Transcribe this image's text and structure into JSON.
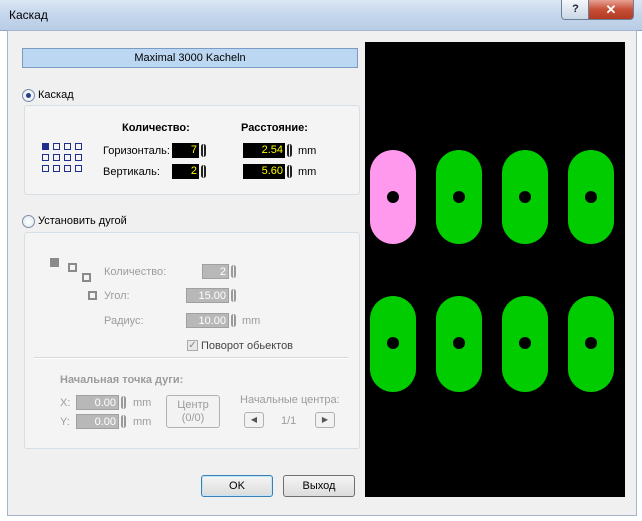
{
  "window": {
    "title": "Каскад",
    "help_glyph": "?",
    "close_glyph": "✕"
  },
  "header": {
    "label": "Maximal 3000 Kacheln"
  },
  "cascade": {
    "radio_label": "Каскад",
    "count_header": "Количество:",
    "distance_header": "Расстояние:",
    "horizontal_label": "Горизонталь:",
    "vertical_label": "Вертикаль:",
    "horizontal_count": "7",
    "vertical_count": "2",
    "horizontal_distance": "2.54",
    "vertical_distance": "5.60",
    "unit": "mm"
  },
  "arc": {
    "radio_label": "Установить дугой",
    "count_label": "Количество:",
    "count_value": "2",
    "angle_label": "Угол:",
    "angle_value": "15.00",
    "radius_label": "Радиус:",
    "radius_value": "10.00",
    "unit": "mm",
    "rotate_label": "Поворот обьектов",
    "rotate_check": "✓",
    "start_title": "Начальная точка дуги:",
    "x_label": "X:",
    "x_value": "0.00",
    "y_label": "Y:",
    "y_value": "0.00",
    "center_button_line1": "Центр",
    "center_button_line2": "(0/0)",
    "start_centers_label": "Начальные центра:",
    "page_indicator": "1/1",
    "prev_glyph": "◀",
    "next_glyph": "▶"
  },
  "buttons": {
    "ok": "OK",
    "exit": "Выход"
  },
  "preview": {
    "pad_color": "#00cc00",
    "selected_pad_color": "#ff99ee",
    "hole_color": "#000000",
    "background": "#000000",
    "rows": 2,
    "columns": 4,
    "selected_pad": "row 1, column 1"
  }
}
